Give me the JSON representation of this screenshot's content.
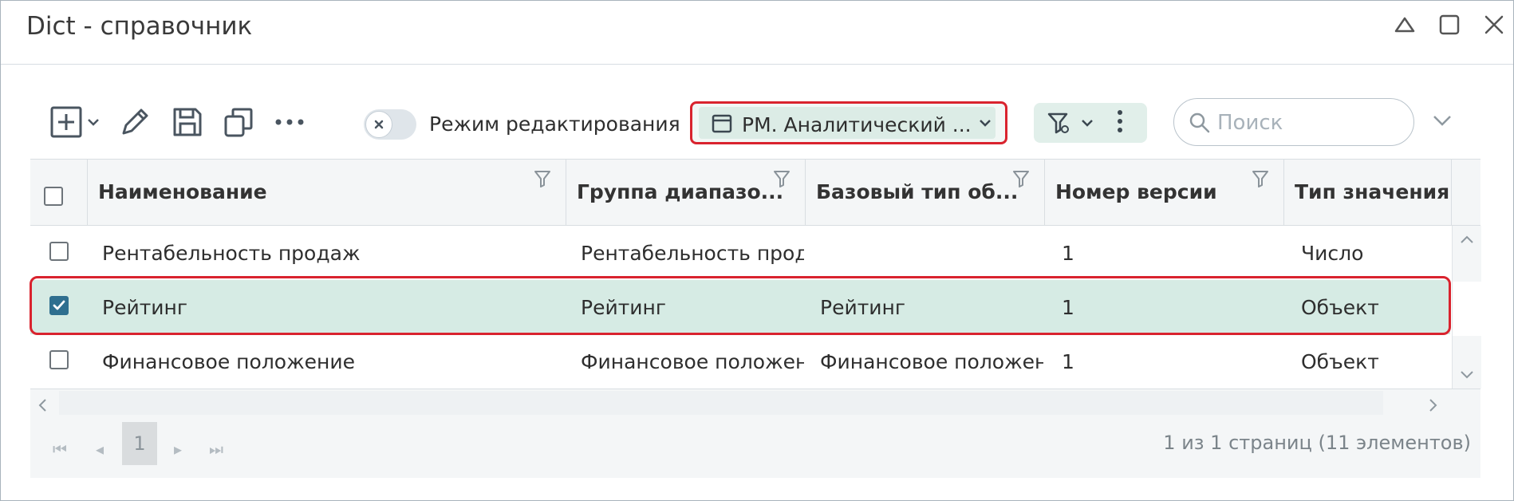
{
  "window": {
    "title": "Dict - справочник",
    "controls": [
      "collapse-icon",
      "maximize-icon",
      "close-icon"
    ]
  },
  "toolbar": {
    "icons": [
      "add-icon",
      "chevron-down-icon",
      "edit-icon",
      "save-icon",
      "copy-icon",
      "more-icon"
    ],
    "edit_mode_label": "Режим редактирования",
    "edit_mode_on": false,
    "view_selector_label": "РМ. Аналитический ...",
    "search_placeholder": "Поиск"
  },
  "table": {
    "columns": [
      {
        "label": "Наименование"
      },
      {
        "label": "Группа диапазо..."
      },
      {
        "label": "Базовый тип об..."
      },
      {
        "label": "Номер версии"
      },
      {
        "label": "Тип значения"
      }
    ],
    "rows": [
      {
        "checked": false,
        "selected": false,
        "cells": [
          "Рентабельность продаж",
          "Рентабельность продаж",
          "",
          "1",
          "Число"
        ]
      },
      {
        "checked": true,
        "selected": true,
        "cells": [
          "Рейтинг",
          "Рейтинг",
          "Рейтинг",
          "1",
          "Объект"
        ]
      },
      {
        "checked": false,
        "selected": false,
        "cells": [
          "Финансовое положение",
          "Финансовое положение",
          "Финансовое положение",
          "1",
          "Объект"
        ]
      }
    ]
  },
  "pager": {
    "current_page": "1",
    "info": "1 из 1 страниц (11 элементов)"
  },
  "colors": {
    "highlight_border": "#d9232e",
    "selected_row": "#d6ebe4",
    "checkbox_checked": "#2f6f8f"
  }
}
